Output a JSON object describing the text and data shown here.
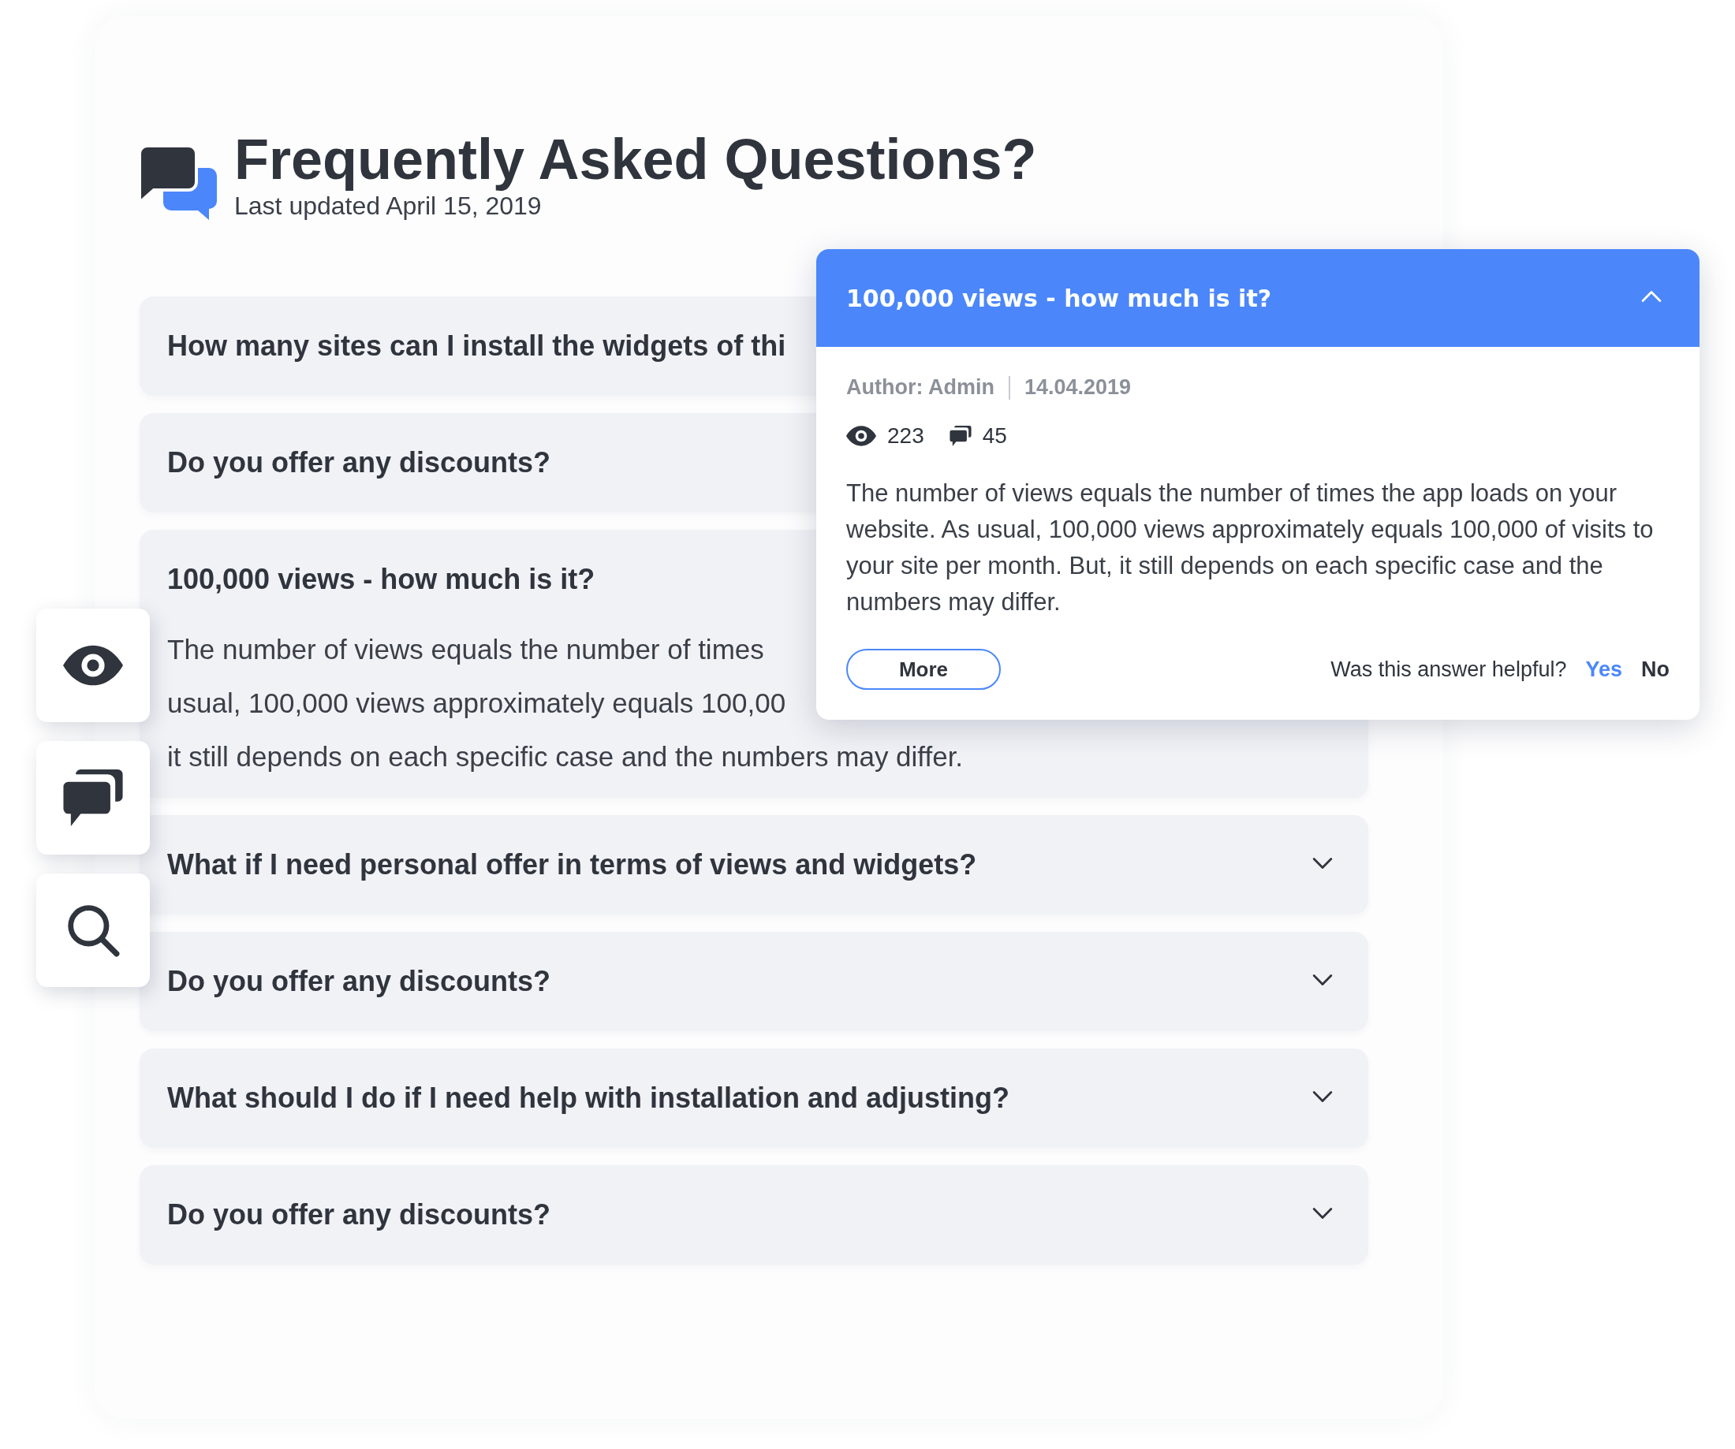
{
  "header": {
    "title": "Frequently Asked Questions?",
    "subtitle": "Last updated April 15, 2019"
  },
  "side_buttons": [
    {
      "kind": "eye"
    },
    {
      "kind": "chat"
    },
    {
      "kind": "search"
    }
  ],
  "faq": [
    {
      "question": "How many sites can I install the widgets of thi",
      "expanded": false,
      "covered": true
    },
    {
      "question": "Do you offer any discounts?",
      "expanded": false,
      "covered": true
    },
    {
      "question": "100,000 views - how much is it?",
      "expanded": true,
      "covered": true,
      "answer_lines": [
        "The number of views equals the number of times",
        "usual, 100,000 views approximately equals 100,00",
        "it still depends on each specific case and the numbers may differ."
      ]
    },
    {
      "question": "What if I need personal offer in terms of views and widgets?",
      "expanded": false,
      "covered": false
    },
    {
      "question": "Do you offer any discounts?",
      "expanded": false,
      "covered": false
    },
    {
      "question": "What should I do if I need help with installation and adjusting?",
      "expanded": false,
      "covered": false
    },
    {
      "question": "Do you offer any discounts?",
      "expanded": false,
      "covered": false
    }
  ],
  "popup": {
    "title": "100,000 views - how much is it?",
    "expanded": true,
    "author": "Author: Admin",
    "date": "14.04.2019",
    "views": "223",
    "comments": "45",
    "answer": "The number of views equals the number of times the app loads on your website. As usual, 100,000 views approximately equals 100,000 of visits to your site per month. But, it still depends on each specific case and the numbers may differ.",
    "more_button": "More",
    "helpful_prompt": "Was this answer helpful?",
    "votes": [
      {
        "label": "Yes",
        "selected": true
      },
      {
        "label": "No",
        "selected": false
      }
    ]
  }
}
